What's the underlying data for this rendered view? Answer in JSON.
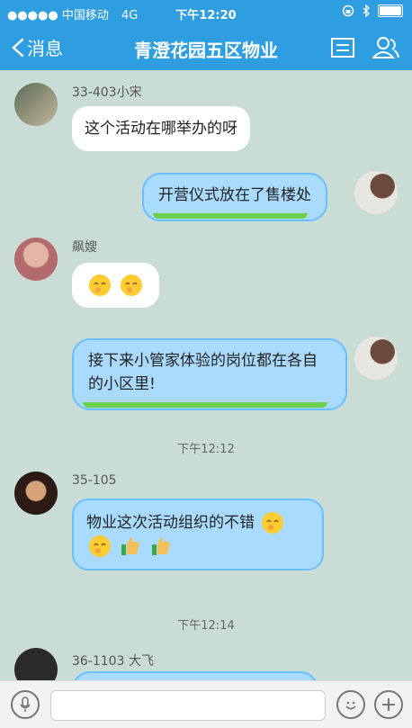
{
  "status_bar": {
    "signal": "●●●●● 中国移动",
    "network": "4G",
    "time": "下午12:20"
  },
  "nav": {
    "back_label": "消息",
    "title": "青澄花园五区物业"
  },
  "messages": [
    {
      "sender": "33-403小宋",
      "text": "这个活动在哪举办的呀"
    },
    {
      "text": "开营仪式放在了售楼处"
    },
    {
      "sender": "飙嫂",
      "text": ""
    },
    {
      "text": "接下来小管家体验的岗位都在各自的小区里!"
    },
    {
      "time": "下午12:12"
    },
    {
      "sender": "35-105",
      "text": "物业这次活动组织的不错"
    },
    {
      "time": "下午12:14"
    },
    {
      "sender": "36-1103 大飞"
    }
  ],
  "icons": {
    "back": "chevron-left-icon",
    "menu": "menu-icon",
    "people": "people-icon",
    "mic": "mic-icon",
    "emoji": "smile-icon",
    "plus": "plus-icon"
  },
  "colors": {
    "header": "#2f9ee0",
    "chat_bg": "#c9dcd6",
    "bubble_blue": "#a9dbff"
  }
}
